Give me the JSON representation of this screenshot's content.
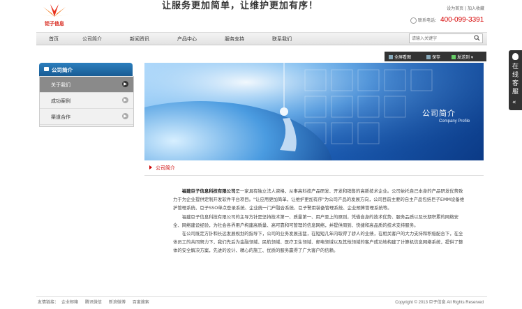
{
  "header": {
    "logo_text": "钜子信息",
    "slogan": "让服务更加简单，让维护更加有序！",
    "toplinks": "设为首页 | 加入收藏",
    "hotline_label": "联系电话：",
    "hotline_number": "400-099-3391"
  },
  "nav": {
    "items": [
      "首页",
      "公司简介",
      "新闻资讯",
      "产品中心",
      "服务支持",
      "联系我们"
    ],
    "search_placeholder": "请输入关键字"
  },
  "toolbar": {
    "fullscreen": "全屏看图",
    "save": "保存",
    "share": "发送到"
  },
  "sidebar": {
    "title": "公司简介",
    "items": [
      {
        "label": "关于我们",
        "active": true
      },
      {
        "label": "成功案例",
        "active": false
      },
      {
        "label": "渠道合作",
        "active": false
      }
    ]
  },
  "banner": {
    "title": "公司简介",
    "subtitle": "Company Profile"
  },
  "breadcrumb": "公司简介",
  "content": {
    "company": "福建巨子信息科技有限公司",
    "p1_rest": "是一家具有独立法人资格，从事高科技产品研发、开发和销售的高新技术企业。公司依托自己本身的产品研发优势致力于为企业提供定制开发软件平台项目。\"让应用更加简单，让维护更加有序\"为公司产品的发展方向，公司目前主要的自主产品包括巨子EMM设备维护管理系统、巨子SSO单点登录系统、企业统一门户融合系统、巨子警用装备管理系统、企业预算管理系统等。",
    "p2": "福建巨子信息科技有限公司的主导方针是坚持技术第一、质量第一、用户至上的原则，凭借自身的技术优势、服务品质以及长期积累的网络安全、网络建设经验，为社会各界用户构建高质量、高可靠和可管理的信息网络，并提供周到、快捷和高品质的技术支持服务。",
    "p3": "在公司既定方针和长远发展规划的指导下，公司的业务发展迅猛，在短短几年内取得了骄人的业绩，在相关客户的大力支持和积极配合下，在全体员工的共同努力下，我们先后为金融领域、民航领域、医疗卫生领域、邮电领域以及其他领域的客户成功地构建了计算机信息网络系统，提供了整体的安全解决方案，先进的设计、精心的施工、优质的服务赢得了广大客户的信赖。"
  },
  "footer": {
    "links_label": "友情链接：",
    "links": [
      "企业邮箱",
      "腾讯微信",
      "新浪微博",
      "百度搜索"
    ],
    "copyright": "Copyright © 2013 巨子信息 All Rights Reserved"
  },
  "online_service": "在线客服",
  "colors": {
    "accent_red": "#d60000",
    "sidebar_blue": "#195c94",
    "toolbar": "#333333"
  }
}
